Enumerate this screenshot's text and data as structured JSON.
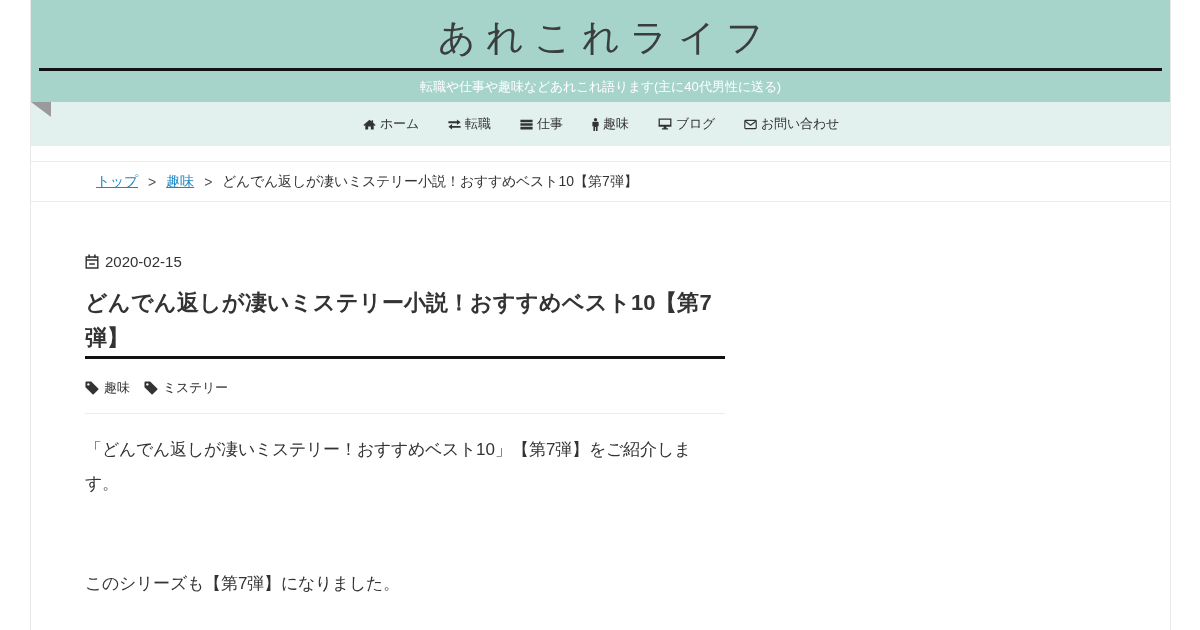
{
  "header": {
    "title": "あれこれライフ",
    "tagline": "転職や仕事や趣味などあれこれ語ります(主に40代男性に送る)"
  },
  "nav": {
    "items": [
      {
        "label": "ホーム"
      },
      {
        "label": "転職"
      },
      {
        "label": "仕事"
      },
      {
        "label": "趣味"
      },
      {
        "label": "ブログ"
      },
      {
        "label": "お問い合わせ"
      }
    ]
  },
  "breadcrumb": [
    {
      "kind": "link",
      "label": "トップ"
    },
    {
      "kind": "separator",
      "label": ">"
    },
    {
      "kind": "link",
      "label": "趣味"
    },
    {
      "kind": "separator",
      "label": ">"
    },
    {
      "kind": "current",
      "label": "どんでん返しが凄いミステリー小説！おすすめベスト10【第7弾】"
    }
  ],
  "article": {
    "date": "2020-02-15",
    "title": "どんでん返しが凄いミステリー小説！おすすめベスト10【第7弾】",
    "tags": [
      {
        "label": "趣味"
      },
      {
        "label": "ミステリー"
      }
    ],
    "paragraphs": [
      "「どんでん返しが凄いミステリー！おすすめベスト10」【第7弾】をご紹介します。",
      "このシリーズも【第7弾】になりました。"
    ]
  }
}
